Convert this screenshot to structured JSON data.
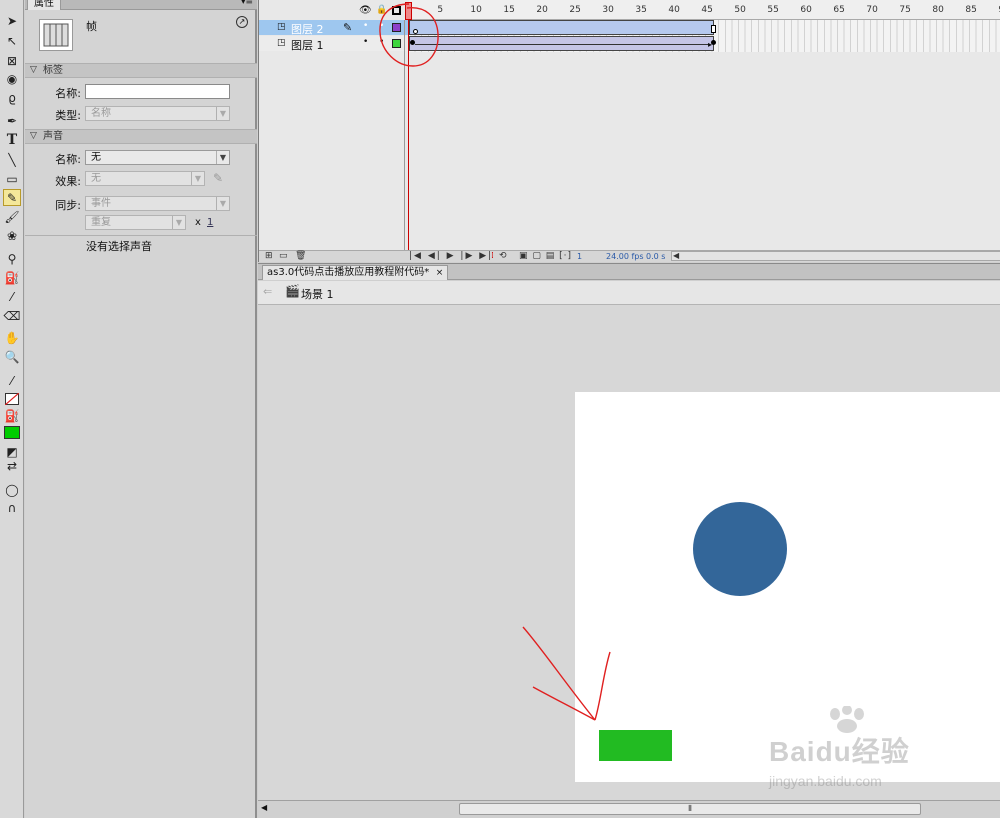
{
  "properties_panel": {
    "tab_label": "属性",
    "frame_type": "帧",
    "label_section": {
      "header": "标签",
      "name_label": "名称:",
      "name_value": "",
      "type_label": "类型:",
      "type_value": "名称"
    },
    "sound_section": {
      "header": "声音",
      "name_label": "名称:",
      "name_value": "无",
      "effect_label": "效果:",
      "effect_value": "无",
      "sync_label": "同步:",
      "sync_value": "事件",
      "repeat_value": "重复",
      "repeat_x": "x",
      "repeat_count": "1",
      "no_sound_text": "没有选择声音"
    }
  },
  "timeline": {
    "ruler_numbers": [
      "1",
      "5",
      "10",
      "15",
      "20",
      "25",
      "30",
      "35",
      "40",
      "45",
      "50",
      "55",
      "60",
      "65",
      "70",
      "75",
      "80",
      "85",
      "9"
    ],
    "layers": [
      {
        "name": "图层 2",
        "selected": true,
        "color": "#8d3fc9"
      },
      {
        "name": "图层 1",
        "selected": false,
        "color": "#3ed63e"
      }
    ],
    "status": {
      "current_frame": "1",
      "fps": "24.00 fps",
      "time": "0.0 s"
    }
  },
  "document": {
    "tab_title": "as3.0代码点击播放应用教程附代码*",
    "tab_close": "×",
    "scene_label": "场景 1"
  },
  "stage_objects": {
    "circle_color": "#336699",
    "rect_color": "#22bb22"
  },
  "watermark": {
    "brand": "Baidu经验",
    "url": "jingyan.baidu.com"
  },
  "colors": {
    "fill_swatch": "#00cc00",
    "annotation": "#e02020",
    "playhead": "#cc0000"
  }
}
